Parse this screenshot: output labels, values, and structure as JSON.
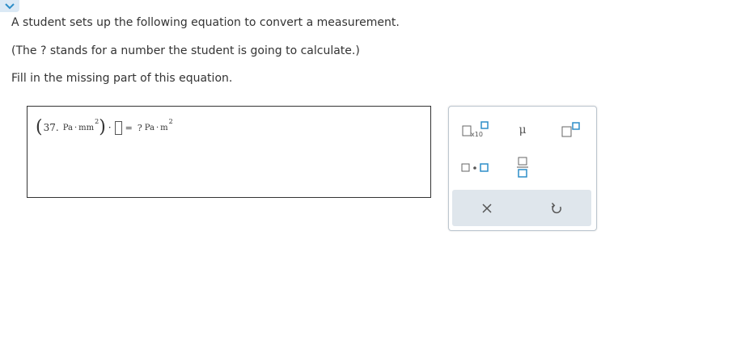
{
  "question": {
    "line1": "A student sets up the following equation to convert a measurement.",
    "line2": "(The ? stands for a number the student is going to calculate.)",
    "line3": "Fill in the missing part of this equation."
  },
  "equation": {
    "value": "37.",
    "unit_left": "Pa",
    "unit_right": "mm",
    "exponent_left": "2",
    "equals": "=",
    "placeholder": "?",
    "result_unit_left": "Pa",
    "result_unit_right": "m",
    "exponent_right": "2"
  },
  "toolbox": {
    "sci_notation_label": "x10",
    "mu_symbol": "μ"
  },
  "colors": {
    "accent_blue": "#2d8dc8",
    "collapse_tab_bg": "#dbe9f5",
    "footer_bg": "#dfe6ec"
  }
}
